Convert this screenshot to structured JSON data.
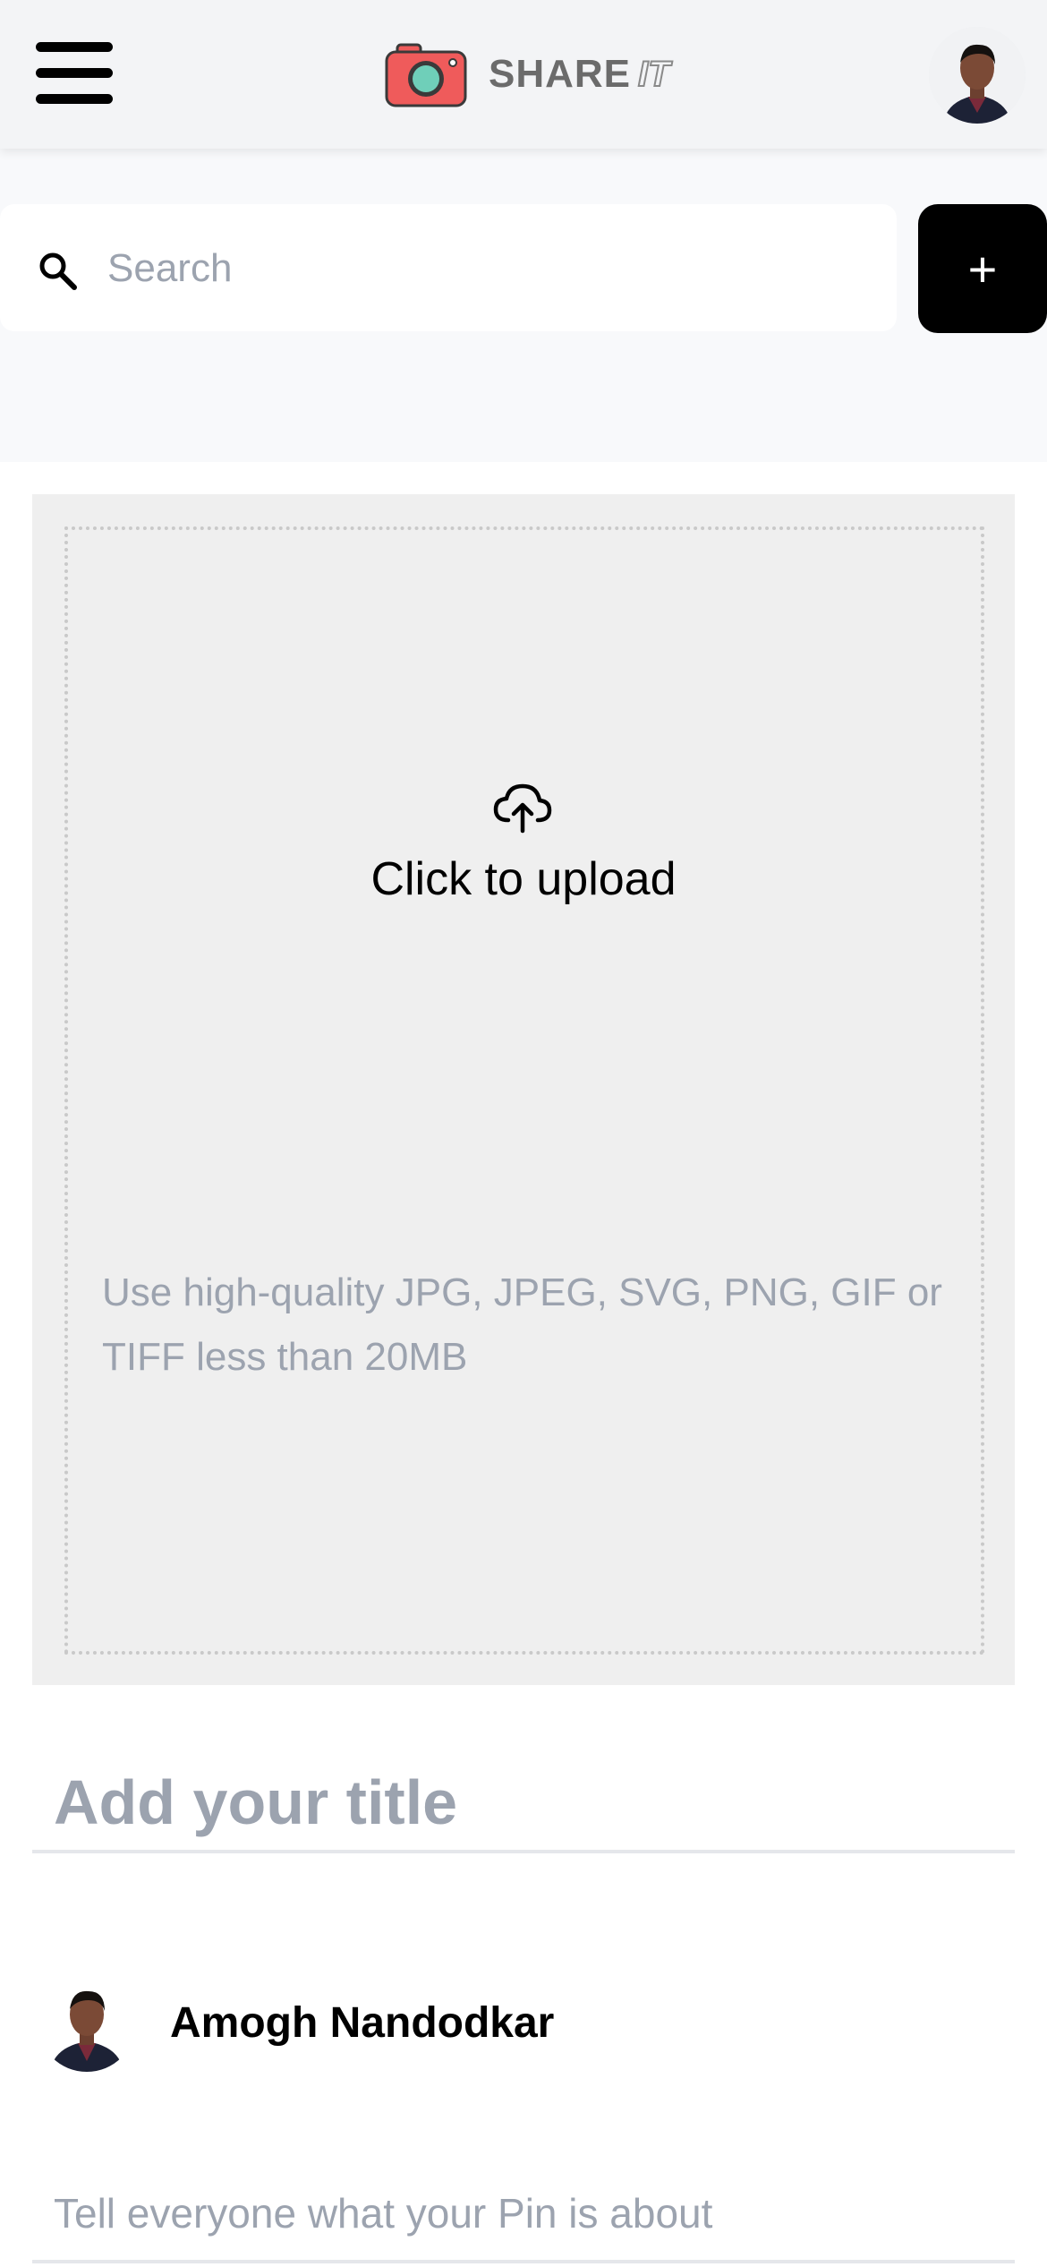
{
  "header": {
    "menu_icon": "hamburger-menu-icon",
    "logo_icon": "camera-icon",
    "logo_text": "SHARE",
    "logo_text_suffix": "IT",
    "avatar_icon": "user-avatar"
  },
  "search": {
    "icon": "search-icon",
    "placeholder": "Search",
    "value": ""
  },
  "add_button": {
    "label": "+"
  },
  "upload": {
    "icon": "cloud-upload-icon",
    "label": "Click to upload",
    "hint": "Use high-quality JPG, JPEG, SVG, PNG, GIF or TIFF less than 20MB"
  },
  "form": {
    "title_placeholder": "Add your title",
    "title_value": "",
    "user_name": "Amogh Nandodkar",
    "about_placeholder": "Tell everyone what your Pin is about",
    "about_value": ""
  },
  "colors": {
    "accent": "#000000",
    "camera_body": "#ef5b5b",
    "camera_lens": "#6fcfb9",
    "muted_text": "#9ca3af",
    "panel_bg": "#efefef"
  }
}
